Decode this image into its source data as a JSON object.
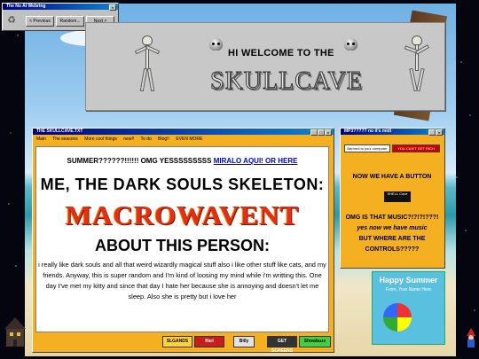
{
  "webring": {
    "title": "The No AI Webring",
    "prev_label": "< Previous",
    "random_label": "Random...",
    "next_label": "Next >"
  },
  "banner": {
    "welcome": "HI WELCOME TO THE",
    "title": "SKULLCAVE"
  },
  "main_window": {
    "title": "THE SKULLCAVE.TXT",
    "menu": [
      "Main",
      "The seasons",
      "More cool things",
      "new!!",
      "To do",
      "Blog!!",
      "EVEN MORE"
    ],
    "summer_text": "SUMMER??????!!!!!! OMG YESSSSSSSSS ",
    "summer_link": "MIRALO AQUI! OR HERE",
    "heading1": "ME, THE DARK SOULS SKELETON:",
    "name": "MACROWAVENT",
    "heading2": "ABOUT THIS PERSON:",
    "about": "i really like dark souls and all that weird wizardly magical stuff also i like other stuff like cats, and my friends. Anyway, this is super random and I'm kind of loosing my mind while i'm writting this. One day I've met my kitty and since that day I hate her because she is annoying and doesn't let me sleep. Also she is pretty but i love her",
    "buttons": [
      "SLGANDS",
      "ffari",
      "Billy",
      "GET SCREENS",
      "Showbuzz"
    ]
  },
  "mp3_window": {
    "title": "MP3????? no it's midi",
    "chip1": "Bermed to your computer",
    "chip2": "YOU CAN'T GET RICH",
    "text1": "NOW WE HAVE A BUTTON",
    "button_label": "SHELL\nCave",
    "text2": "OMG IS THAT MUSIC?!?!?!???!",
    "text3": "yes now we have music",
    "text4": "BUT WHERE ARE THE",
    "text5": "CONTROLS?????"
  },
  "summer_card": {
    "title": "Happy Summer",
    "subtitle": "From, Your Name Here"
  },
  "colors": {
    "window": "#f5b021",
    "titlebar": "#000080",
    "macro": "#e03018"
  }
}
